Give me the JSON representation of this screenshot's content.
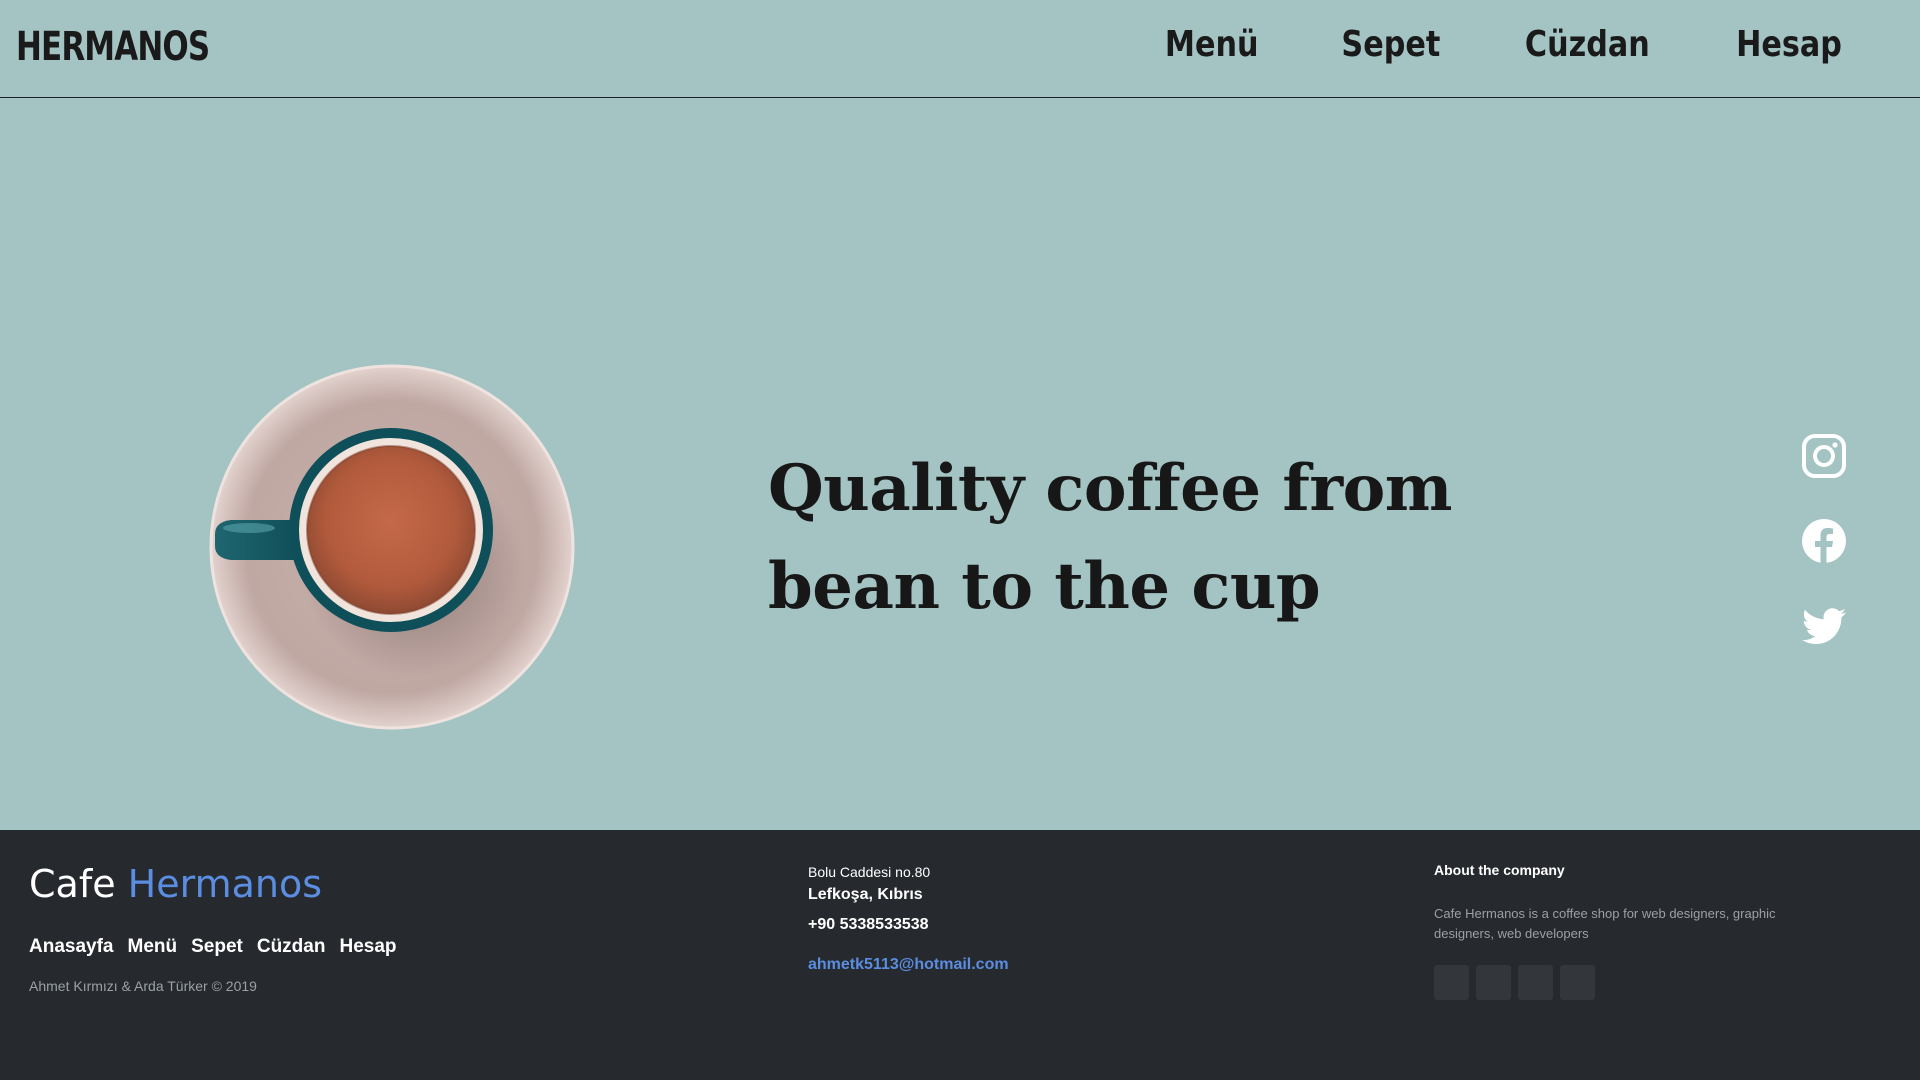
{
  "header": {
    "brand": "HERMANOS",
    "nav": [
      {
        "label": "Menü"
      },
      {
        "label": "Sepet"
      },
      {
        "label": "Cüzdan"
      },
      {
        "label": "Hesap"
      }
    ]
  },
  "hero": {
    "headline": "Quality coffee from bean to the cup",
    "social": [
      "instagram-icon",
      "facebook-icon",
      "twitter-icon"
    ]
  },
  "footer": {
    "logo_part1": "Cafe",
    "logo_part2": "Hermanos",
    "links": [
      "Anasayfa",
      "Menü",
      "Sepet",
      "Cüzdan",
      "Hesap"
    ],
    "copyright": "Ahmet Kırmızı & Arda Türker © 2019",
    "street": "Bolu Caddesi no.80",
    "city": "Lefkoşa, Kıbrıs",
    "phone": "+90 5338533538",
    "email": "ahmetk5113@hotmail.com",
    "about_title": "About the company",
    "about_text": "Cafe Hermanos is a coffee shop for web designers, graphic designers, web developers"
  },
  "colors": {
    "background": "#a4c3c3",
    "footer": "#262a2f",
    "accent": "#5b8de0",
    "text": "#1a1a1a"
  }
}
